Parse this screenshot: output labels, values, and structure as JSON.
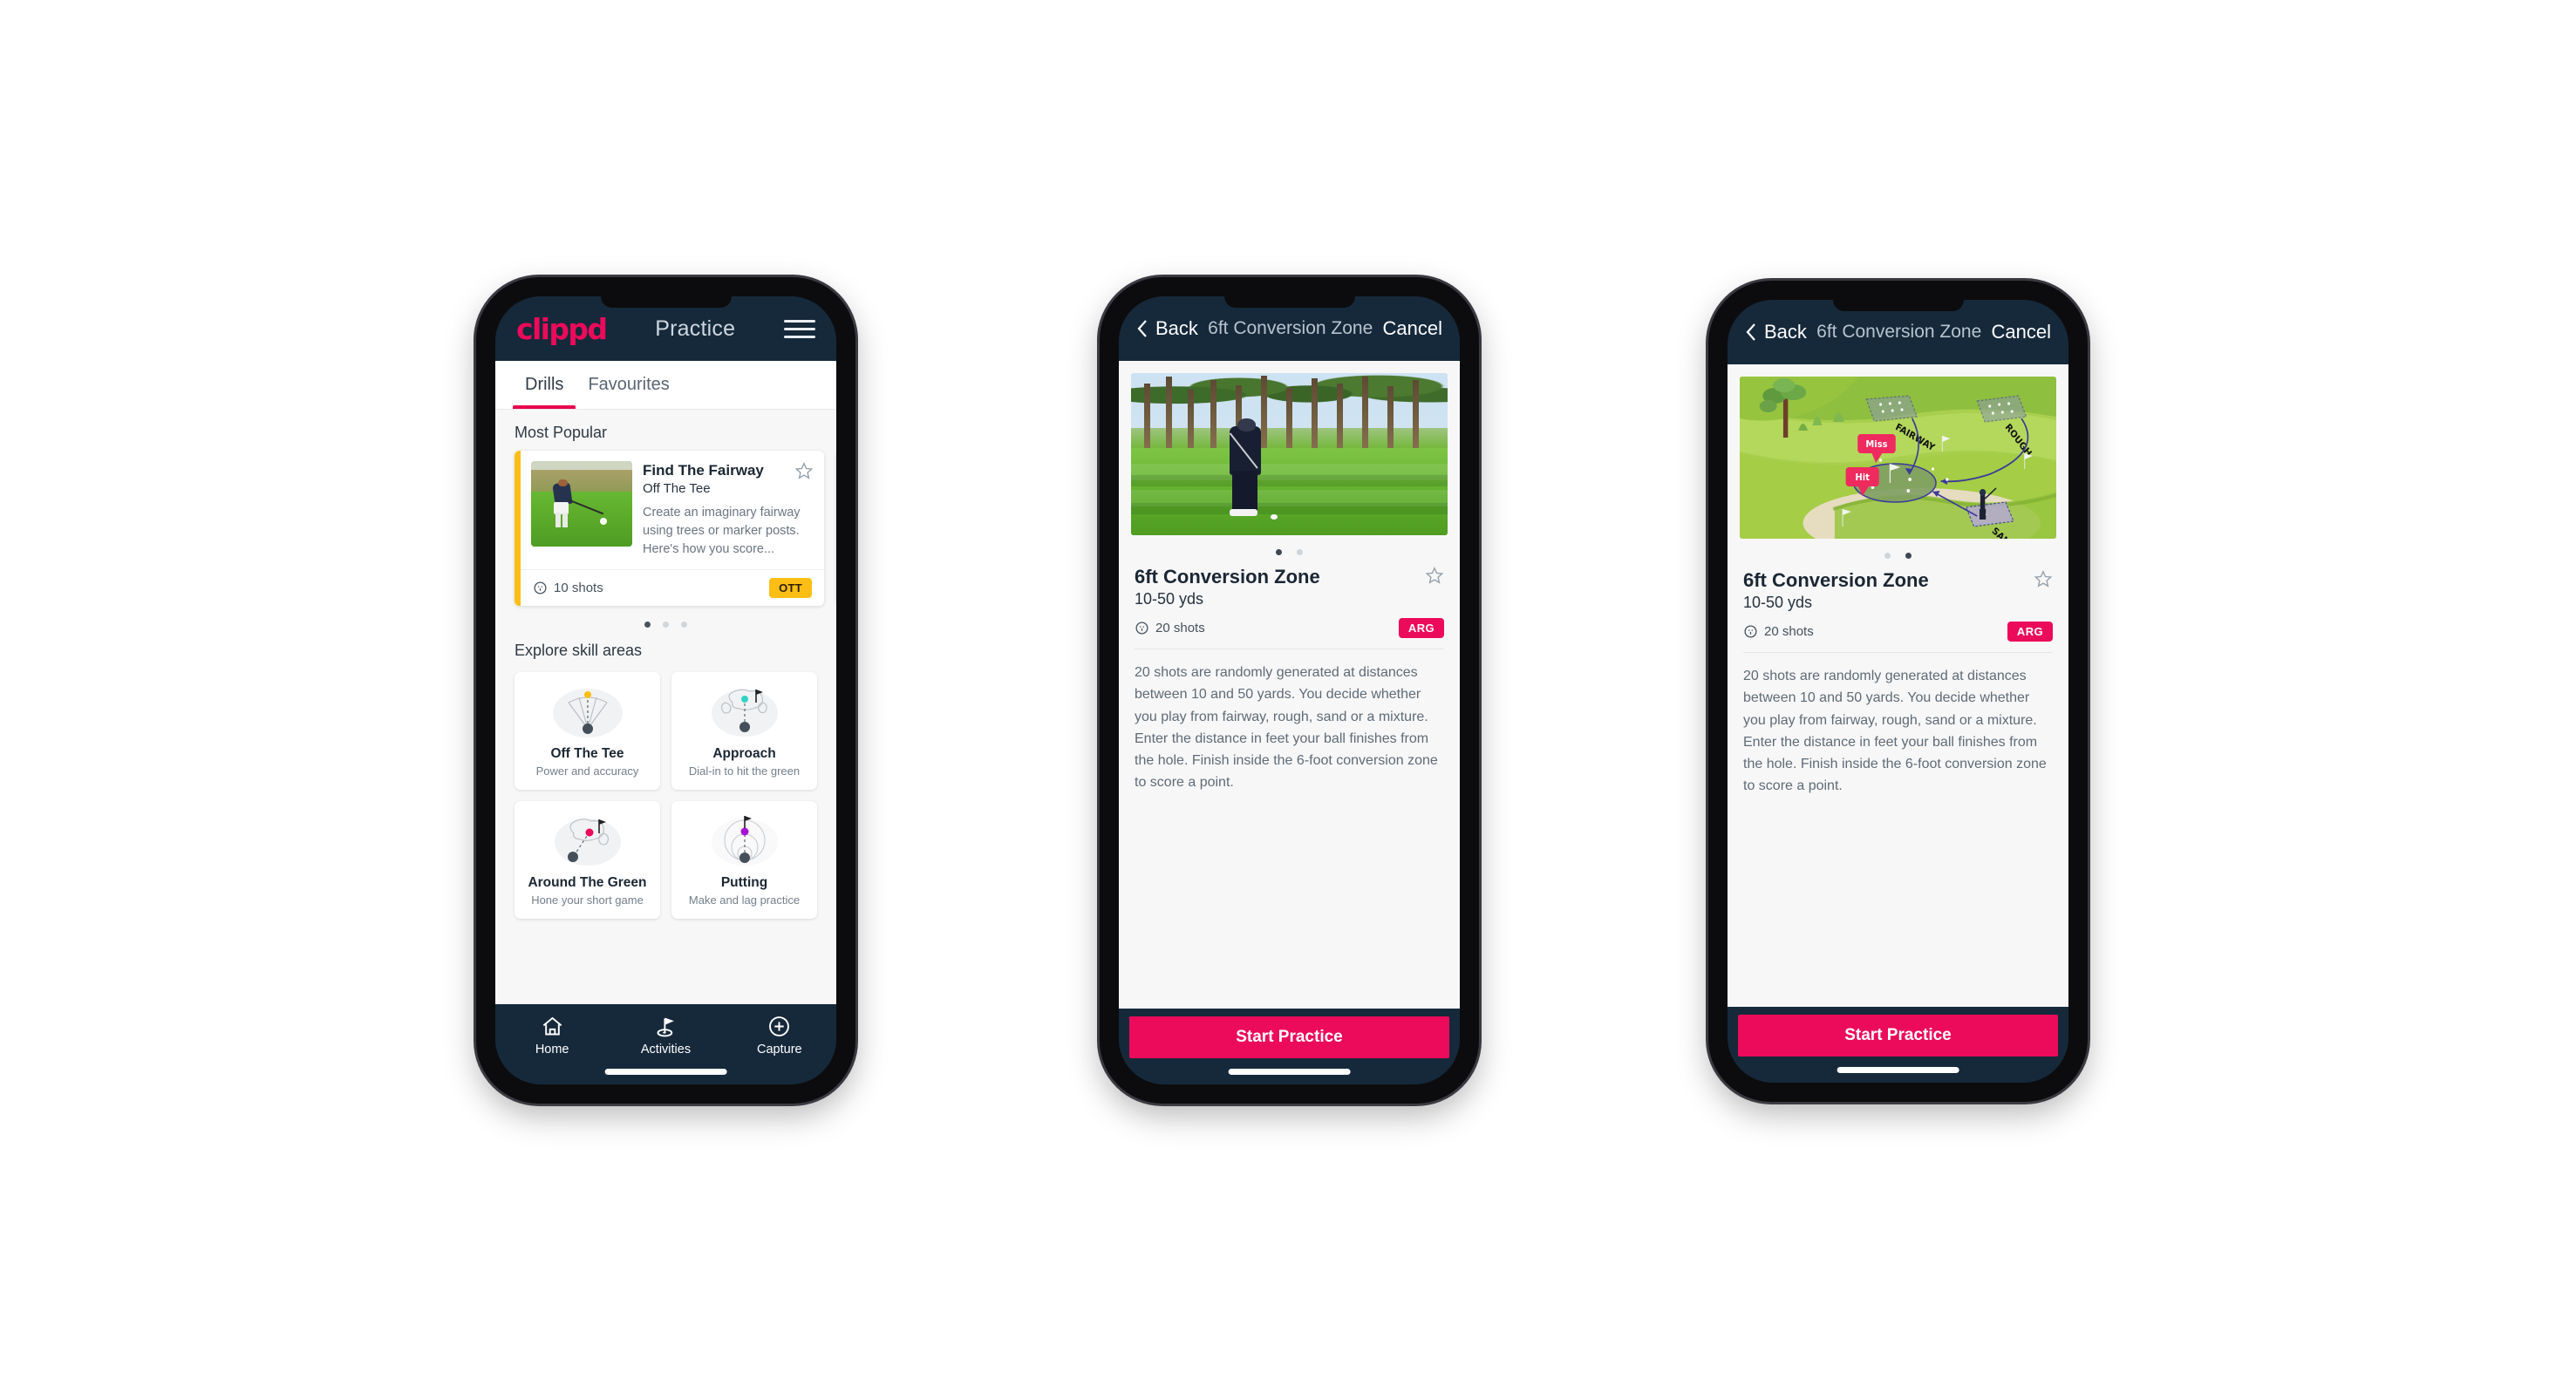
{
  "app": {
    "brand": "clippd",
    "brand_color": "#ec0a5a",
    "navbar_color": "#16293b"
  },
  "phone1": {
    "header": {
      "logo": "clippd",
      "title": "Practice",
      "menu_icon": "hamburger-menu-icon"
    },
    "tabs": [
      {
        "label": "Drills",
        "active": true
      },
      {
        "label": "Favourites",
        "active": false
      }
    ],
    "most_popular": {
      "section_label": "Most Popular",
      "cards": [
        {
          "accent_color": "#fcbe15",
          "title": "Find The Fairway",
          "subtitle": "Off The Tee",
          "description": "Create an imaginary fairway using trees or marker posts. Here's how you score...",
          "shots": "10 shots",
          "badge": "OTT",
          "badge_color": "#fcbe15",
          "favourite": false
        },
        {
          "accent_color": "#2fd4c4"
        }
      ],
      "dots": [
        true,
        false,
        false
      ]
    },
    "explore": {
      "section_label": "Explore skill areas",
      "cards": [
        {
          "name": "Off The Tee",
          "desc": "Power and accuracy",
          "icon": "tee-fan-icon",
          "dot_color": "#fcbe15"
        },
        {
          "name": "Approach",
          "desc": "Dial-in to hit the green",
          "icon": "green-approach-icon",
          "dot_color": "#2fd4c4"
        },
        {
          "name": "Around The Green",
          "desc": "Hone your short game",
          "icon": "chip-around-green-icon",
          "dot_color": "#ec0a5a"
        },
        {
          "name": "Putting",
          "desc": "Make and lag practice",
          "icon": "putting-rings-icon",
          "dot_color": "#a612d4"
        }
      ]
    },
    "bottom_nav": [
      {
        "label": "Home",
        "icon": "home-icon",
        "active": false
      },
      {
        "label": "Activities",
        "icon": "golf-flag-hole-icon",
        "active": true
      },
      {
        "label": "Capture",
        "icon": "plus-circle-icon",
        "active": false
      }
    ]
  },
  "phone2": {
    "navbar": {
      "back": "Back",
      "title": "6ft Conversion Zone",
      "cancel": "Cancel"
    },
    "hero": "golf-swing-video-still",
    "dots": [
      true,
      false
    ],
    "detail": {
      "title": "6ft Conversion Zone",
      "subtitle": "10-50 yds",
      "shots": "20 shots",
      "badge": "ARG",
      "badge_color": "#ec0a5a",
      "description": "20 shots are randomly generated at distances between 10 and 50 yards. You decide whether you play from fairway, rough, sand or a mixture. Enter the distance in feet your ball finishes from the hole. Finish inside the 6-foot conversion zone to score a point."
    },
    "cta": "Start Practice"
  },
  "phone3": {
    "navbar": {
      "back": "Back",
      "title": "6ft Conversion Zone",
      "cancel": "Cancel"
    },
    "hero": "isometric-course-diagram",
    "map_labels": {
      "fairway": "FAIRWAY",
      "rough": "ROUGH",
      "sand": "SAND",
      "miss": "Miss",
      "hit": "Hit"
    },
    "dots": [
      false,
      true
    ],
    "detail": {
      "title": "6ft Conversion Zone",
      "subtitle": "10-50 yds",
      "shots": "20 shots",
      "badge": "ARG",
      "badge_color": "#ec0a5a",
      "description": "20 shots are randomly generated at distances between 10 and 50 yards. You decide whether you play from fairway, rough, sand or a mixture. Enter the distance in feet your ball finishes from the hole. Finish inside the 6-foot conversion zone to score a point."
    },
    "cta": "Start Practice"
  }
}
